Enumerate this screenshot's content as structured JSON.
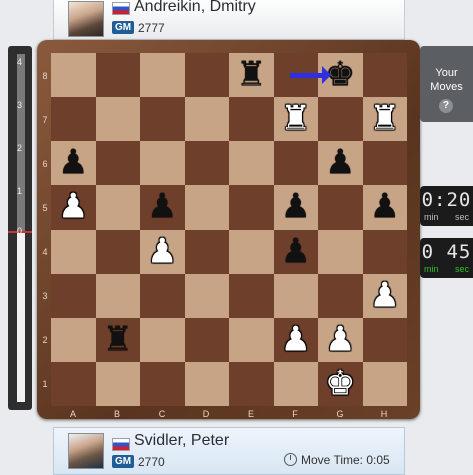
{
  "top_player": {
    "name": "Andreikin, Dmitry",
    "title": "GM",
    "rating": "2777",
    "flag": "russia-flag"
  },
  "bottom_player": {
    "name": "Svidler, Peter",
    "title": "GM",
    "rating": "2770",
    "flag": "russia-flag",
    "move_time_label": "Move Time: 0:05"
  },
  "eval_bar": {
    "labels": [
      "4",
      "3",
      "2",
      "1",
      "0",
      "1",
      "2",
      "3",
      "4"
    ]
  },
  "board": {
    "ranks": [
      "8",
      "7",
      "6",
      "5",
      "4",
      "3",
      "2",
      "1"
    ],
    "files": [
      "A",
      "B",
      "C",
      "D",
      "E",
      "F",
      "G",
      "H"
    ],
    "position": [
      [
        "",
        "",
        "",
        "",
        "bR",
        "",
        "bK",
        ""
      ],
      [
        "",
        "",
        "",
        "",
        "",
        "wR",
        "",
        "wR"
      ],
      [
        "bP",
        "",
        "",
        "",
        "",
        "",
        "bP",
        ""
      ],
      [
        "wP",
        "",
        "bP",
        "",
        "",
        "bP",
        "",
        "bP"
      ],
      [
        "",
        "",
        "wP",
        "",
        "",
        "bP",
        "",
        ""
      ],
      [
        "",
        "",
        "",
        "",
        "",
        "",
        "",
        "wP"
      ],
      [
        "",
        "bR",
        "",
        "",
        "",
        "wP",
        "wP",
        ""
      ],
      [
        "",
        "",
        "",
        "",
        "",
        "",
        "wK",
        ""
      ]
    ],
    "arrow_color": "#2d2fe0"
  },
  "your_moves": {
    "line1": "Your",
    "line2": "Moves",
    "help": "?"
  },
  "clock_top": {
    "time": "0:20",
    "min_label": "min",
    "sec_label": "sec"
  },
  "clock_bottom": {
    "time": "0 45",
    "min_label": "min",
    "sec_label": "sec"
  }
}
